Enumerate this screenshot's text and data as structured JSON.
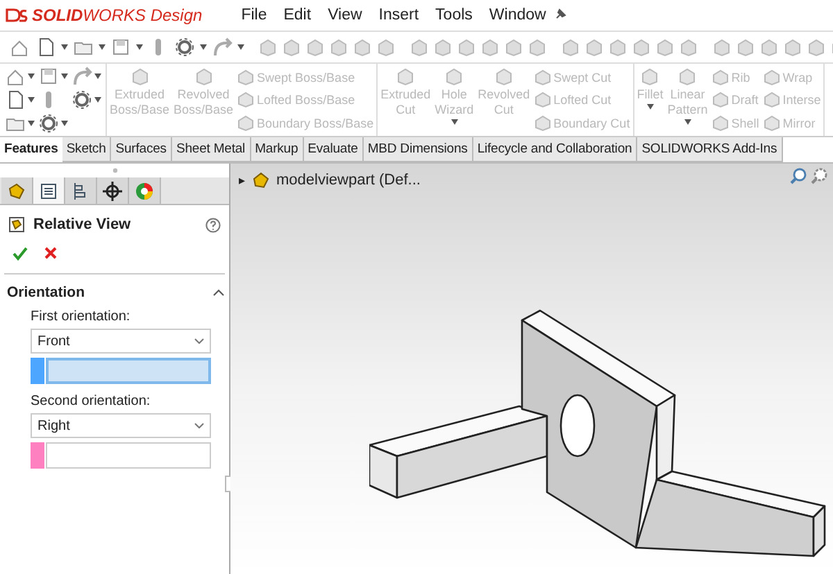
{
  "app": {
    "brand": "**SOLID**WORKS Design"
  },
  "menu": [
    "File",
    "Edit",
    "View",
    "Insert",
    "Tools",
    "Window"
  ],
  "command_groups": [
    {
      "large": [
        {
          "label": "Extruded Boss/Base",
          "disabled": true,
          "dropdown": false
        },
        {
          "label": "Revolved Boss/Base",
          "disabled": true,
          "dropdown": false
        }
      ],
      "list": [
        {
          "label": "Swept Boss/Base",
          "disabled": true
        },
        {
          "label": "Lofted Boss/Base",
          "disabled": true
        },
        {
          "label": "Boundary Boss/Base",
          "disabled": true
        }
      ]
    },
    {
      "large": [
        {
          "label": "Extruded Cut",
          "disabled": true,
          "dropdown": false
        },
        {
          "label": "Hole Wizard",
          "disabled": true,
          "dropdown": true
        },
        {
          "label": "Revolved Cut",
          "disabled": true,
          "dropdown": false
        }
      ],
      "list": [
        {
          "label": "Swept Cut",
          "disabled": true
        },
        {
          "label": "Lofted Cut",
          "disabled": true
        },
        {
          "label": "Boundary Cut",
          "disabled": true
        }
      ]
    },
    {
      "large": [
        {
          "label": "Fillet",
          "disabled": true,
          "dropdown": true
        },
        {
          "label": "Linear Pattern",
          "disabled": true,
          "dropdown": true
        }
      ],
      "list": [
        {
          "label": "Rib",
          "disabled": true
        },
        {
          "label": "Draft",
          "disabled": true
        },
        {
          "label": "Shell",
          "disabled": true
        }
      ],
      "list2": [
        {
          "label": "Wrap",
          "disabled": true
        },
        {
          "label": "Interse",
          "disabled": true
        },
        {
          "label": "Mirror",
          "disabled": true
        }
      ]
    }
  ],
  "tabs": [
    {
      "label": "Features",
      "selected": true
    },
    {
      "label": "Sketch",
      "selected": false
    },
    {
      "label": "Surfaces",
      "selected": false
    },
    {
      "label": "Sheet Metal",
      "selected": false
    },
    {
      "label": "Markup",
      "selected": false
    },
    {
      "label": "Evaluate",
      "selected": false
    },
    {
      "label": "MBD Dimensions",
      "selected": false
    },
    {
      "label": "Lifecycle and Collaboration",
      "selected": false
    },
    {
      "label": "SOLIDWORKS Add-Ins",
      "selected": false
    }
  ],
  "panel_tabs": [
    {
      "kind": "feature",
      "selected": false
    },
    {
      "kind": "property",
      "selected": true
    },
    {
      "kind": "config",
      "selected": false
    },
    {
      "kind": "dimxpert",
      "selected": false
    },
    {
      "kind": "display",
      "selected": false
    }
  ],
  "property": {
    "title": "Relative View",
    "sections": [
      {
        "title": "Orientation",
        "expanded": true,
        "fields": [
          {
            "label": "First orientation:",
            "value": "Front",
            "color": "#4da6ff",
            "active": true
          },
          {
            "label": "Second orientation:",
            "value": "Right",
            "color": "#ff80c0",
            "active": false
          }
        ]
      }
    ]
  },
  "tree": {
    "arrow": "▸",
    "label": "modelviewpart (Def..."
  }
}
